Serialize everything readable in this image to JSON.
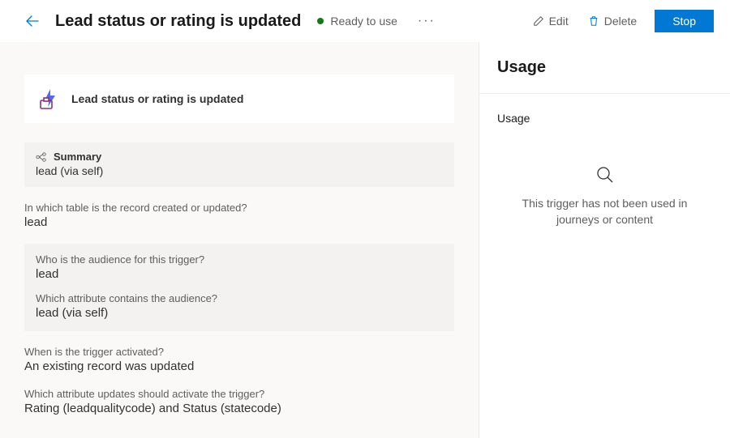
{
  "header": {
    "title": "Lead status or rating is updated",
    "status_label": "Ready to use",
    "edit_label": "Edit",
    "delete_label": "Delete",
    "stop_label": "Stop"
  },
  "main": {
    "trigger_title": "Lead status or rating is updated",
    "summary": {
      "head": "Summary",
      "sub": "lead (via self)"
    },
    "q_table": {
      "label": "In which table is the record created or updated?",
      "value": "lead"
    },
    "q_audience": {
      "label": "Who is the audience for this trigger?",
      "value": "lead"
    },
    "q_attribute": {
      "label": "Which attribute contains the audience?",
      "value": "lead (via self)"
    },
    "q_activated": {
      "label": "When is the trigger activated?",
      "value": "An existing record was updated"
    },
    "q_updates": {
      "label": "Which attribute updates should activate the trigger?",
      "value": "Rating (leadqualitycode) and Status (statecode)"
    }
  },
  "usage": {
    "header": "Usage",
    "subhead": "Usage",
    "empty_text": "This trigger has not been used in journeys or content"
  }
}
